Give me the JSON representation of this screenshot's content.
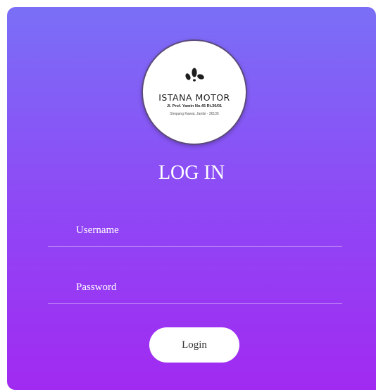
{
  "logo": {
    "icon": "drops-logo-icon",
    "name": "ISTANA MOTOR",
    "address_line1": "Jl. Prof. Yamin No.45 Rt.30/01",
    "address_line2": "Simpang Kawat, Jambi - 36135"
  },
  "title": "LOG IN",
  "form": {
    "username_placeholder": "Username",
    "password_placeholder": "Password",
    "login_label": "Login"
  },
  "colors": {
    "gradient_top": "#7a6ff6",
    "gradient_bottom": "#a12af1",
    "text": "#ffffff"
  }
}
